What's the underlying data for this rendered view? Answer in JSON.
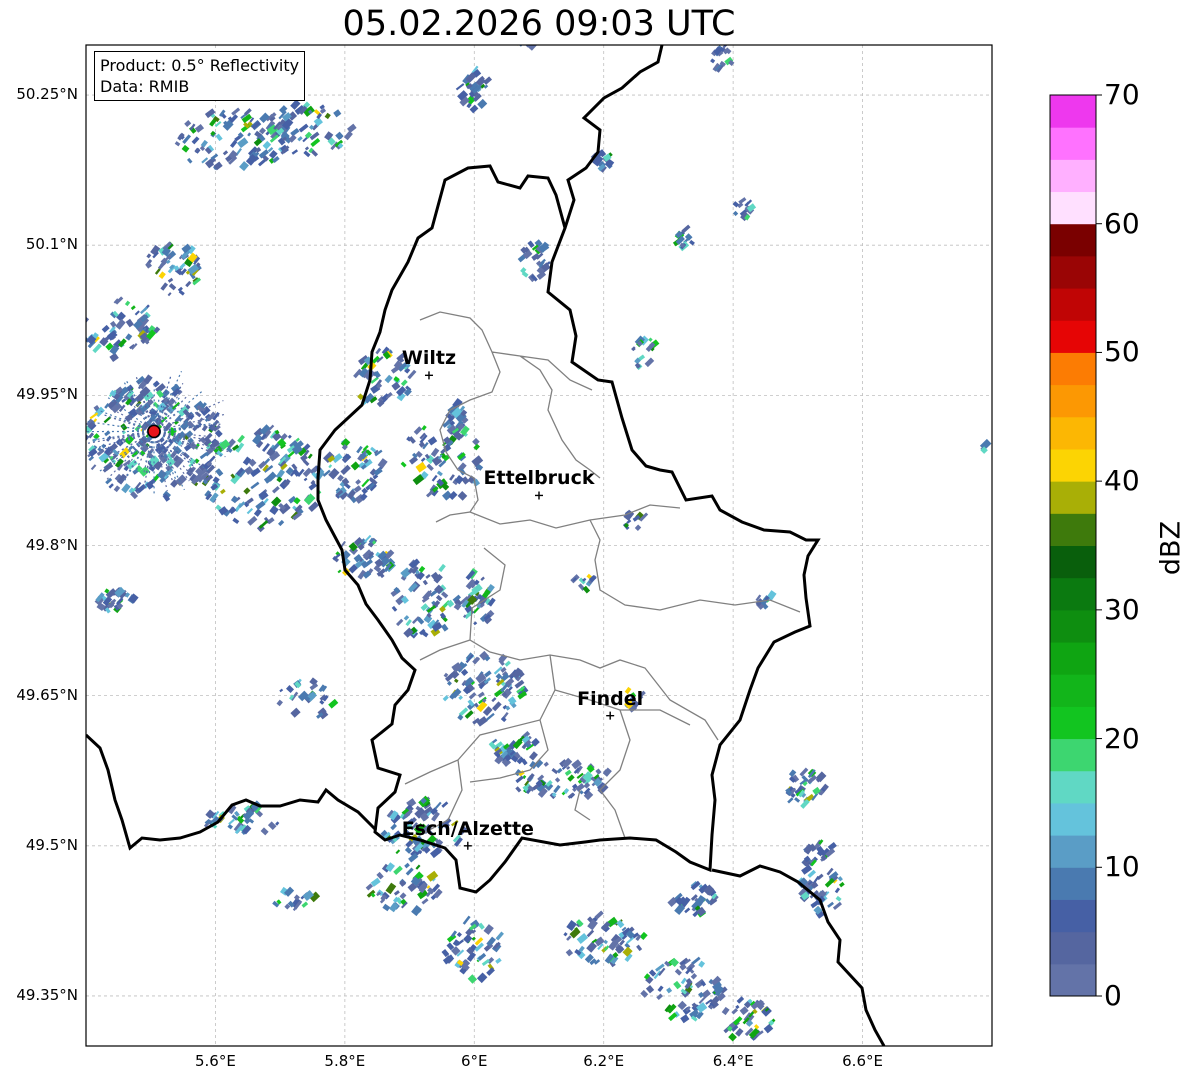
{
  "title": "05.02.2026 09:03 UTC",
  "info": {
    "product": "Product: 0.5° Reflectivity",
    "data": "Data: RMIB"
  },
  "lat_ticks": [
    {
      "value": 50.25,
      "label": "50.25°N"
    },
    {
      "value": 50.1,
      "label": "50.1°N"
    },
    {
      "value": 49.95,
      "label": "49.95°N"
    },
    {
      "value": 49.8,
      "label": "49.8°N"
    },
    {
      "value": 49.65,
      "label": "49.65°N"
    },
    {
      "value": 49.5,
      "label": "49.5°N"
    },
    {
      "value": 49.35,
      "label": "49.35°N"
    }
  ],
  "lon_ticks": [
    {
      "value": 5.6,
      "label": "5.6°E"
    },
    {
      "value": 5.8,
      "label": "5.8°E"
    },
    {
      "value": 6.0,
      "label": "6°E"
    },
    {
      "value": 6.2,
      "label": "6.2°E"
    },
    {
      "value": 6.4,
      "label": "6.4°E"
    },
    {
      "value": 6.6,
      "label": "6.6°E"
    }
  ],
  "extent": {
    "lon_min": 5.4,
    "lon_max": 6.8,
    "lat_min": 49.3,
    "lat_max": 50.3
  },
  "cities": [
    {
      "name": "Wiltz",
      "lon": 5.93,
      "lat": 49.97
    },
    {
      "name": "Ettelbruck",
      "lon": 6.1,
      "lat": 49.85
    },
    {
      "name": "Findel",
      "lon": 6.21,
      "lat": 49.63
    },
    {
      "name": "Esch/Alzette",
      "lon": 5.99,
      "lat": 49.5
    }
  ],
  "radar_site": {
    "lon": 5.505,
    "lat": 49.914
  },
  "colorbar": {
    "label": "dBZ",
    "min": 0,
    "max": 70,
    "ticks": [
      "0",
      "10",
      "20",
      "30",
      "40",
      "50",
      "60",
      "70"
    ],
    "colors": [
      "#6373a8",
      "#5566a0",
      "#4660a5",
      "#4a7ab0",
      "#5a9dc6",
      "#64c3dc",
      "#60d8c4",
      "#3dd670",
      "#12c520",
      "#12b51a",
      "#0fa512",
      "#0e8e10",
      "#0b7a10",
      "#095f0c",
      "#3e7a0c",
      "#a9af06",
      "#fcd403",
      "#fcb703",
      "#fc9803",
      "#fc7c03",
      "#e60505",
      "#c00505",
      "#9a0505",
      "#7a0000",
      "#ffe0ff",
      "#ffb0ff",
      "#ff72ff",
      "#ee38ee"
    ]
  },
  "colors": {
    "border": "#000000",
    "admin": "#808080",
    "grid": "#bfbfbf",
    "site": "#e8151b"
  }
}
